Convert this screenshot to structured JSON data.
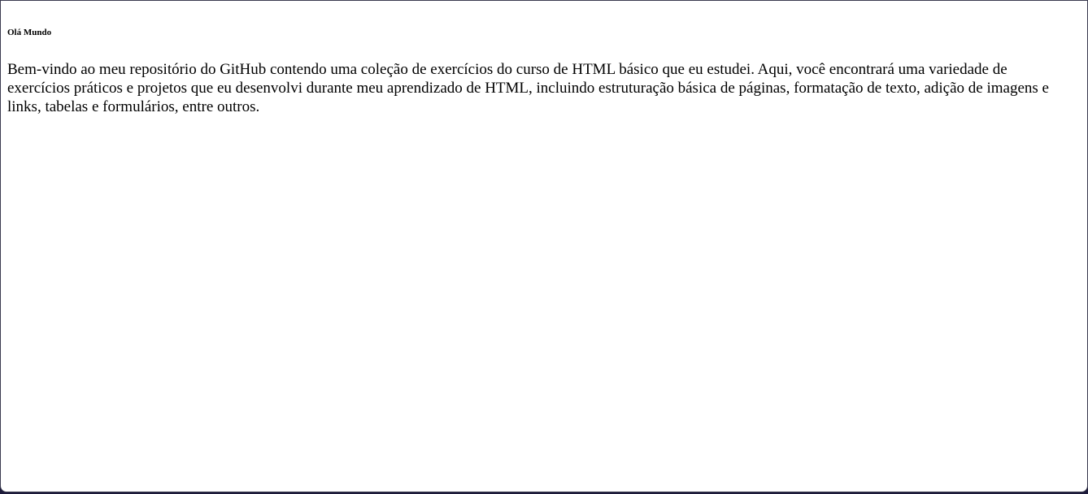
{
  "page": {
    "heading": "Olá Mundo",
    "paragraph": "Bem-vindo ao meu repositório do GitHub contendo uma coleção de exercícios do curso de HTML básico que eu estudei. Aqui, você encontrará uma variedade de exercícios práticos e projetos que eu desenvolvi durante meu aprendizado de HTML, incluindo estruturação básica de páginas, formatação de texto, adição de imagens e links, tabelas e formulários, entre outros."
  }
}
